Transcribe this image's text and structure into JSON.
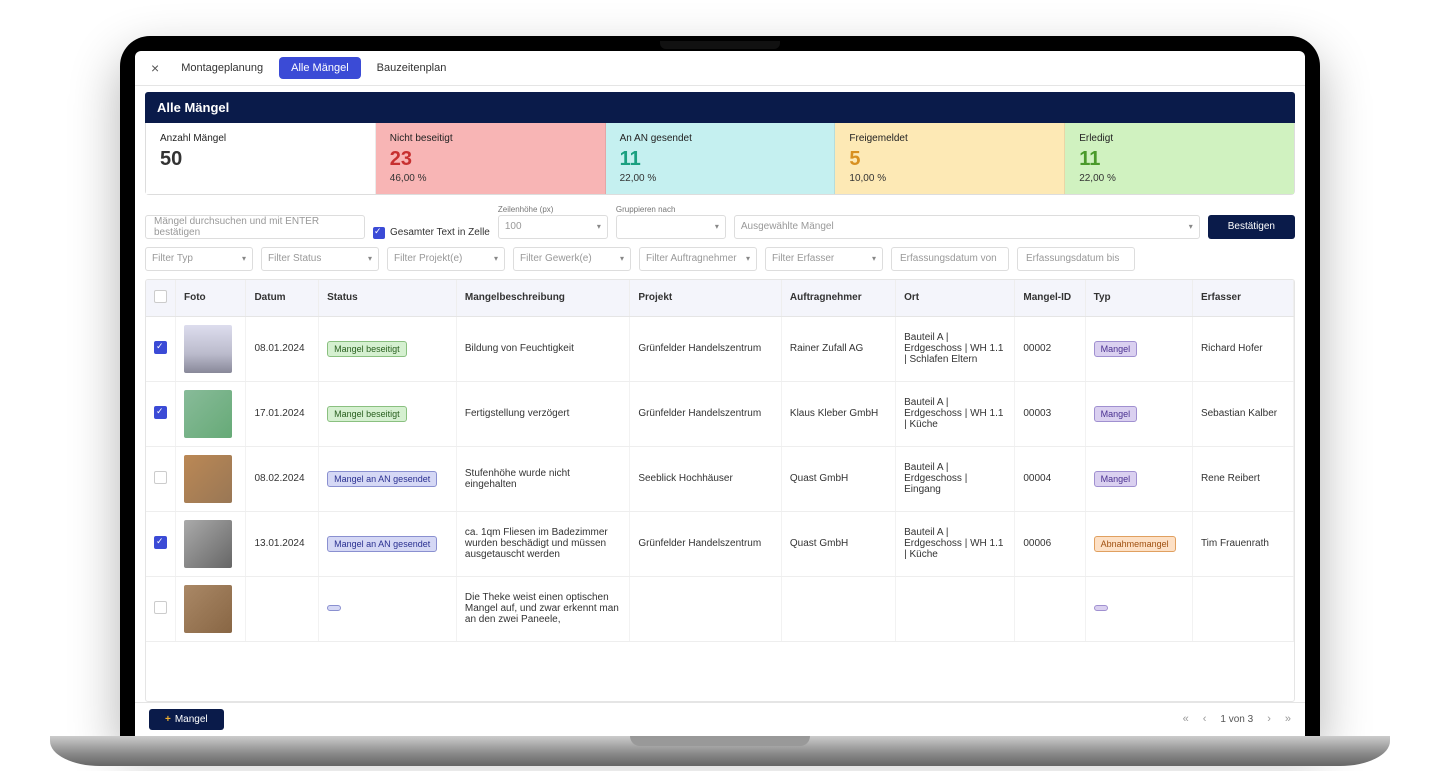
{
  "tabs": {
    "close": "×",
    "items": [
      "Montageplanung",
      "Alle Mängel",
      "Bauzeitenplan"
    ],
    "active_index": 1
  },
  "page_title": "Alle Mängel",
  "stats": [
    {
      "label": "Anzahl Mängel",
      "value": "50",
      "pct": "",
      "color": "white",
      "vcolor": ""
    },
    {
      "label": "Nicht beseitigt",
      "value": "23",
      "pct": "46,00 %",
      "color": "red",
      "vcolor": "red"
    },
    {
      "label": "An AN gesendet",
      "value": "11",
      "pct": "22,00 %",
      "color": "cyan",
      "vcolor": "teal"
    },
    {
      "label": "Freigemeldet",
      "value": "5",
      "pct": "10,00 %",
      "color": "yellow",
      "vcolor": "orange"
    },
    {
      "label": "Erledigt",
      "value": "11",
      "pct": "22,00 %",
      "color": "green",
      "vcolor": "green"
    }
  ],
  "controls": {
    "search_placeholder": "Mängel durchsuchen und mit ENTER bestätigen",
    "checkbox_label": "Gesamter Text in Zelle",
    "row_height_label": "Zeilenhöhe (px)",
    "row_height_value": "100",
    "group_by_label": "Gruppieren nach",
    "group_by_value": "",
    "selected_defects_placeholder": "Ausgewählte Mängel",
    "confirm_button": "Bestätigen",
    "filters": {
      "type": "Filter Typ",
      "status": "Filter Status",
      "project": "Filter Projekt(e)",
      "gewerk": "Filter Gewerk(e)",
      "auftragnehmer": "Filter Auftragnehmer",
      "erfasser": "Filter Erfasser",
      "date_from": "Erfassungsdatum von",
      "date_to": "Erfassungsdatum bis"
    }
  },
  "table": {
    "headers": [
      "",
      "Foto",
      "Datum",
      "Status",
      "Mangelbeschreibung",
      "Projekt",
      "Auftragnehmer",
      "Ort",
      "Mangel-ID",
      "Typ",
      "Erfasser"
    ],
    "rows": [
      {
        "checked": true,
        "thumb": "t1",
        "date": "08.01.2024",
        "status": "Mangel beseitigt",
        "status_color": "green",
        "desc": "Bildung von Feuchtigkeit",
        "project": "Grünfelder Handelszentrum",
        "contractor": "Rainer Zufall AG",
        "location": "Bauteil A | Erdgeschoss | WH 1.1 | Schlafen Eltern",
        "id": "00002",
        "type": "Mangel",
        "type_color": "purple",
        "erfasser": "Richard Hofer"
      },
      {
        "checked": true,
        "thumb": "t2",
        "date": "17.01.2024",
        "status": "Mangel beseitigt",
        "status_color": "green",
        "desc": "Fertigstellung verzögert",
        "project": "Grünfelder Handelszentrum",
        "contractor": "Klaus Kleber GmbH",
        "location": "Bauteil A | Erdgeschoss | WH 1.1 | Küche",
        "id": "00003",
        "type": "Mangel",
        "type_color": "purple",
        "erfasser": "Sebastian Kalber"
      },
      {
        "checked": false,
        "thumb": "t3",
        "date": "08.02.2024",
        "status": "Mangel an AN gesendet",
        "status_color": "blue",
        "desc": "Stufenhöhe wurde nicht eingehalten",
        "project": "Seeblick Hochhäuser",
        "contractor": "Quast GmbH",
        "location": "Bauteil A | Erdgeschoss | Eingang",
        "id": "00004",
        "type": "Mangel",
        "type_color": "purple",
        "erfasser": "Rene Reibert"
      },
      {
        "checked": true,
        "thumb": "t4",
        "date": "13.01.2024",
        "status": "Mangel an AN gesendet",
        "status_color": "blue",
        "desc": "ca. 1qm Fliesen im Badezimmer wurden beschädigt und müssen ausgetauscht werden",
        "project": "Grünfelder Handelszentrum",
        "contractor": "Quast GmbH",
        "location": "Bauteil A | Erdgeschoss | WH 1.1 | Küche",
        "id": "00006",
        "type": "Abnahmemangel",
        "type_color": "orange",
        "erfasser": "Tim Frauenrath"
      },
      {
        "checked": false,
        "thumb": "t5",
        "date": "",
        "status": "",
        "status_color": "blue",
        "desc": "Die Theke weist einen optischen Mangel auf, und zwar erkennt man an den zwei Paneele,",
        "project": "",
        "contractor": "",
        "location": "",
        "id": "",
        "type": "",
        "type_color": "purple",
        "erfasser": ""
      }
    ]
  },
  "footer": {
    "add_label": "Mangel",
    "page_text": "1  von  3"
  }
}
